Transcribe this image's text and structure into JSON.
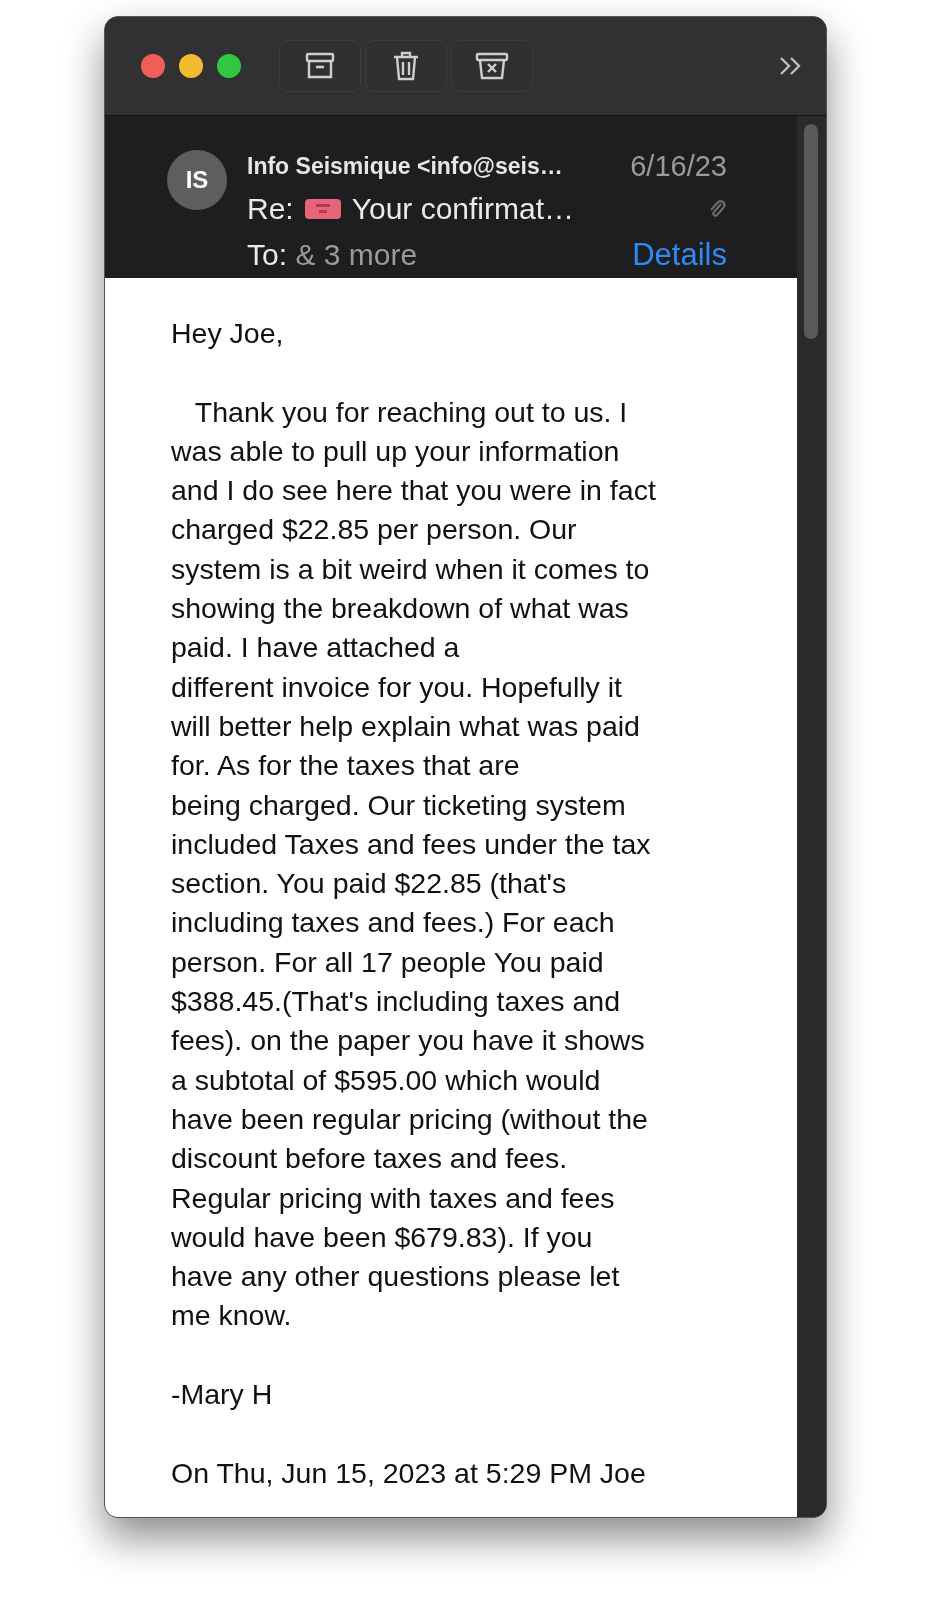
{
  "header": {
    "avatar": "IS",
    "sender": "Info Seismique <info@seis…",
    "date": "6/16/23",
    "subject_prefix": "Re:",
    "subject": "Your confirmat…",
    "to_label": "To:",
    "recipients": "& 3 more",
    "details": "Details"
  },
  "body": {
    "greeting": "Hey Joe,",
    "paragraph": "   Thank you for reaching out to us. I\nwas able to pull up your information\nand I do see here that you were in fact\ncharged $22.85 per person. Our\nsystem is a bit weird when it comes to\nshowing the breakdown of what was\npaid. I have attached a\ndifferent invoice for you. Hopefully it\nwill better help explain what was paid\nfor. As for the taxes that are\nbeing charged. Our ticketing system\nincluded Taxes and fees under the tax\nsection. You paid $22.85 (that's\nincluding taxes and fees.) For each\nperson. For all 17 people You paid\n$388.45.(That's including taxes and\nfees). on the paper you have it shows\na subtotal of $595.00 which would\nhave been regular pricing (without the\ndiscount before taxes and fees.\nRegular pricing with taxes and fees\nwould have been $679.83). If you\nhave any other questions please let\nme know.",
    "signature": "-Mary H",
    "quote_header": "On Thu, Jun 15, 2023 at 5:29 PM Joe"
  }
}
